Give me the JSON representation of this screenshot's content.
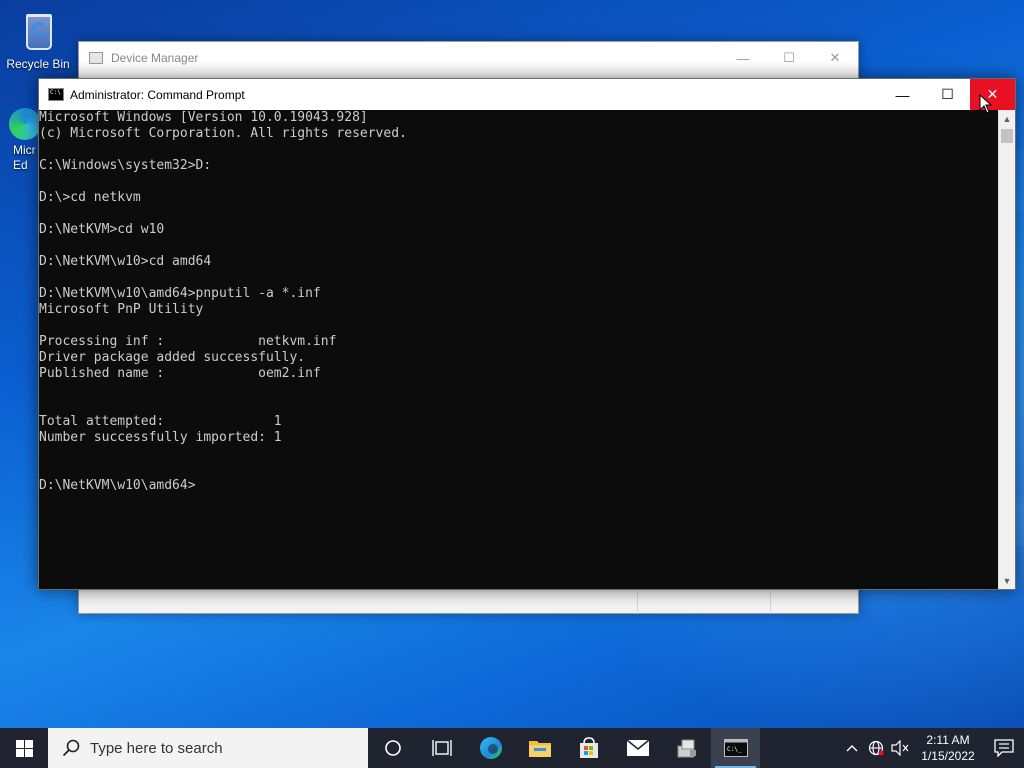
{
  "desktop": {
    "icons": [
      {
        "label": "Recycle Bin",
        "icon": "recycle-bin-icon"
      },
      {
        "label": "Micr Ed",
        "icon": "edge-icon"
      }
    ]
  },
  "device_manager": {
    "title": "Device Manager",
    "controls": {
      "minimize": "—",
      "maximize": "☐",
      "close": "✕"
    }
  },
  "cmd": {
    "title": "Administrator: Command Prompt",
    "controls": {
      "minimize": "—",
      "maximize": "☐",
      "close": "✕"
    },
    "lines": [
      "Microsoft Windows [Version 10.0.19043.928]",
      "(c) Microsoft Corporation. All rights reserved.",
      "",
      "C:\\Windows\\system32>D:",
      "",
      "D:\\>cd netkvm",
      "",
      "D:\\NetKVM>cd w10",
      "",
      "D:\\NetKVM\\w10>cd amd64",
      "",
      "D:\\NetKVM\\w10\\amd64>pnputil -a *.inf",
      "Microsoft PnP Utility",
      "",
      "Processing inf :            netkvm.inf",
      "Driver package added successfully.",
      "Published name :            oem2.inf",
      "",
      "",
      "Total attempted:              1",
      "Number successfully imported: 1",
      "",
      "",
      "D:\\NetKVM\\w10\\amd64>"
    ],
    "colors": {
      "background": "#0c0c0c",
      "text": "#cccccc",
      "close_hover": "#e81123"
    }
  },
  "taskbar": {
    "search_placeholder": "Type here to search",
    "pinned": [
      {
        "icon": "task-view-icon"
      },
      {
        "icon": "timeline-icon"
      },
      {
        "icon": "edge-icon"
      },
      {
        "icon": "file-explorer-icon"
      },
      {
        "icon": "store-icon"
      },
      {
        "icon": "mail-icon"
      },
      {
        "icon": "device-manager-icon"
      },
      {
        "icon": "command-prompt-icon",
        "active": true
      }
    ],
    "tray": {
      "time": "2:11 AM",
      "date": "1/15/2022"
    },
    "colors": {
      "background": "#1f2430",
      "accent": "#76b9ed"
    }
  }
}
